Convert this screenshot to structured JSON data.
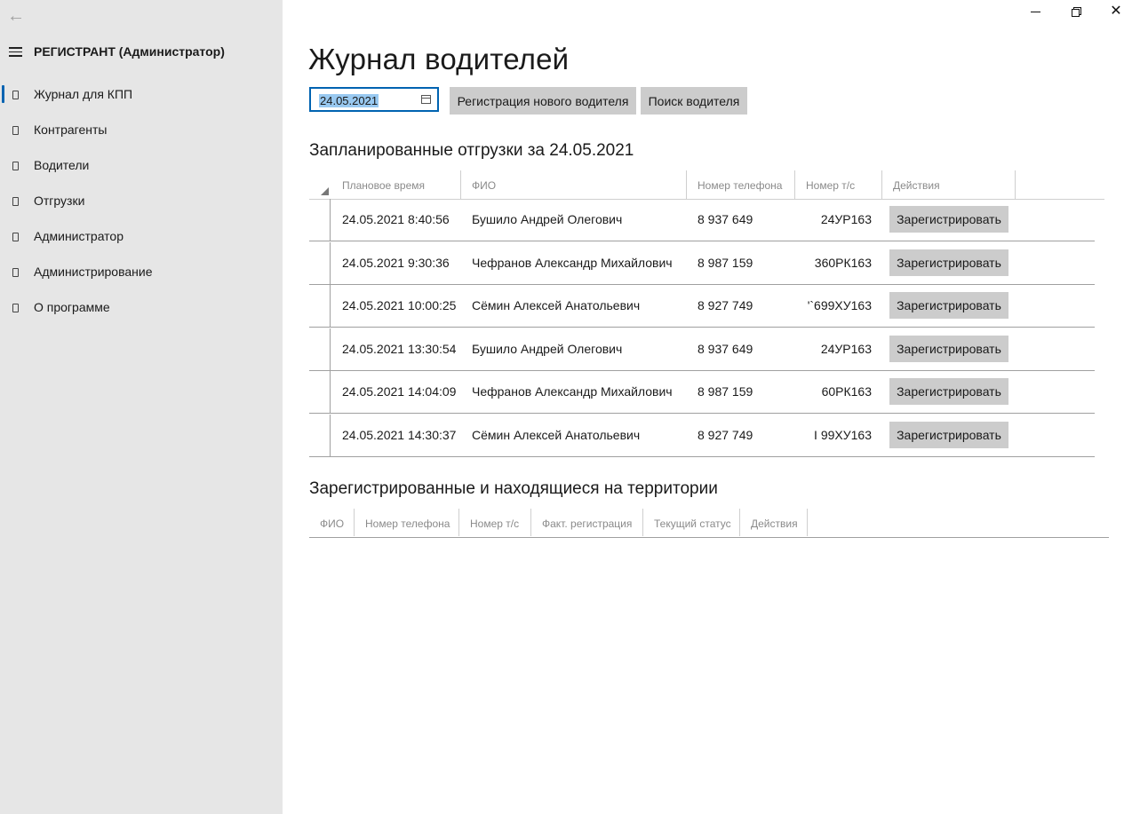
{
  "nav": {
    "app_title": "РЕГИСТРАНТ (Администратор)",
    "items": [
      {
        "label": "Журнал для КПП"
      },
      {
        "label": "Контрагенты"
      },
      {
        "label": "Водители"
      },
      {
        "label": "Отгрузки"
      },
      {
        "label": "Администратор"
      },
      {
        "label": "Администрирование"
      },
      {
        "label": "О программе"
      }
    ]
  },
  "page": {
    "title": "Журнал водителей",
    "date_value": "24.05.2021",
    "register_button": "Регистрация нового водителя",
    "search_button": "Поиск водителя"
  },
  "planned": {
    "title": "Запланированные отгрузки за 24.05.2021",
    "columns": [
      "Плановое время",
      "ФИО",
      "Номер телефона",
      "Номер т/с",
      "Действия"
    ],
    "rows": [
      {
        "time": "24.05.2021 8:40:56",
        "fio": "Бушило Андрей Олегович",
        "phone": "8 937 649",
        "plate": "24УР163",
        "action": "Зарегистрировать"
      },
      {
        "time": "24.05.2021 9:30:36",
        "fio": "Чефранов  Александр Михайлович",
        "phone": "8 987 159",
        "plate": "360РК163",
        "action": "Зарегистрировать"
      },
      {
        "time": "24.05.2021 10:00:25",
        "fio": "Сёмин Алексей Анатольевич",
        "phone": "8 927 749",
        "plate": "'`699ХУ163",
        "action": "Зарегистрировать"
      },
      {
        "time": "24.05.2021 13:30:54",
        "fio": "Бушило Андрей Олегович",
        "phone": "8 937 649",
        "plate": "24УР163",
        "action": "Зарегистрировать"
      },
      {
        "time": "24.05.2021 14:04:09",
        "fio": "Чефранов  Александр Михайлович",
        "phone": "8 987 159",
        "plate": "60РК163",
        "action": "Зарегистрировать"
      },
      {
        "time": "24.05.2021 14:30:37",
        "fio": "Сёмин Алексей Анатольевич",
        "phone": "8 927 749",
        "plate": "I  99ХУ163",
        "action": "Зарегистрировать"
      }
    ]
  },
  "registered": {
    "title": "Зарегистрированные и находящиеся на территории",
    "columns": [
      "ФИО",
      "Номер телефона",
      "Номер т/с",
      "Факт. регистрация",
      "Текущий статус",
      "Действия"
    ]
  },
  "colors": {
    "sidebar_bg": "#e6e6e6",
    "accent": "#0063b1",
    "button_bg": "#cccccc"
  }
}
